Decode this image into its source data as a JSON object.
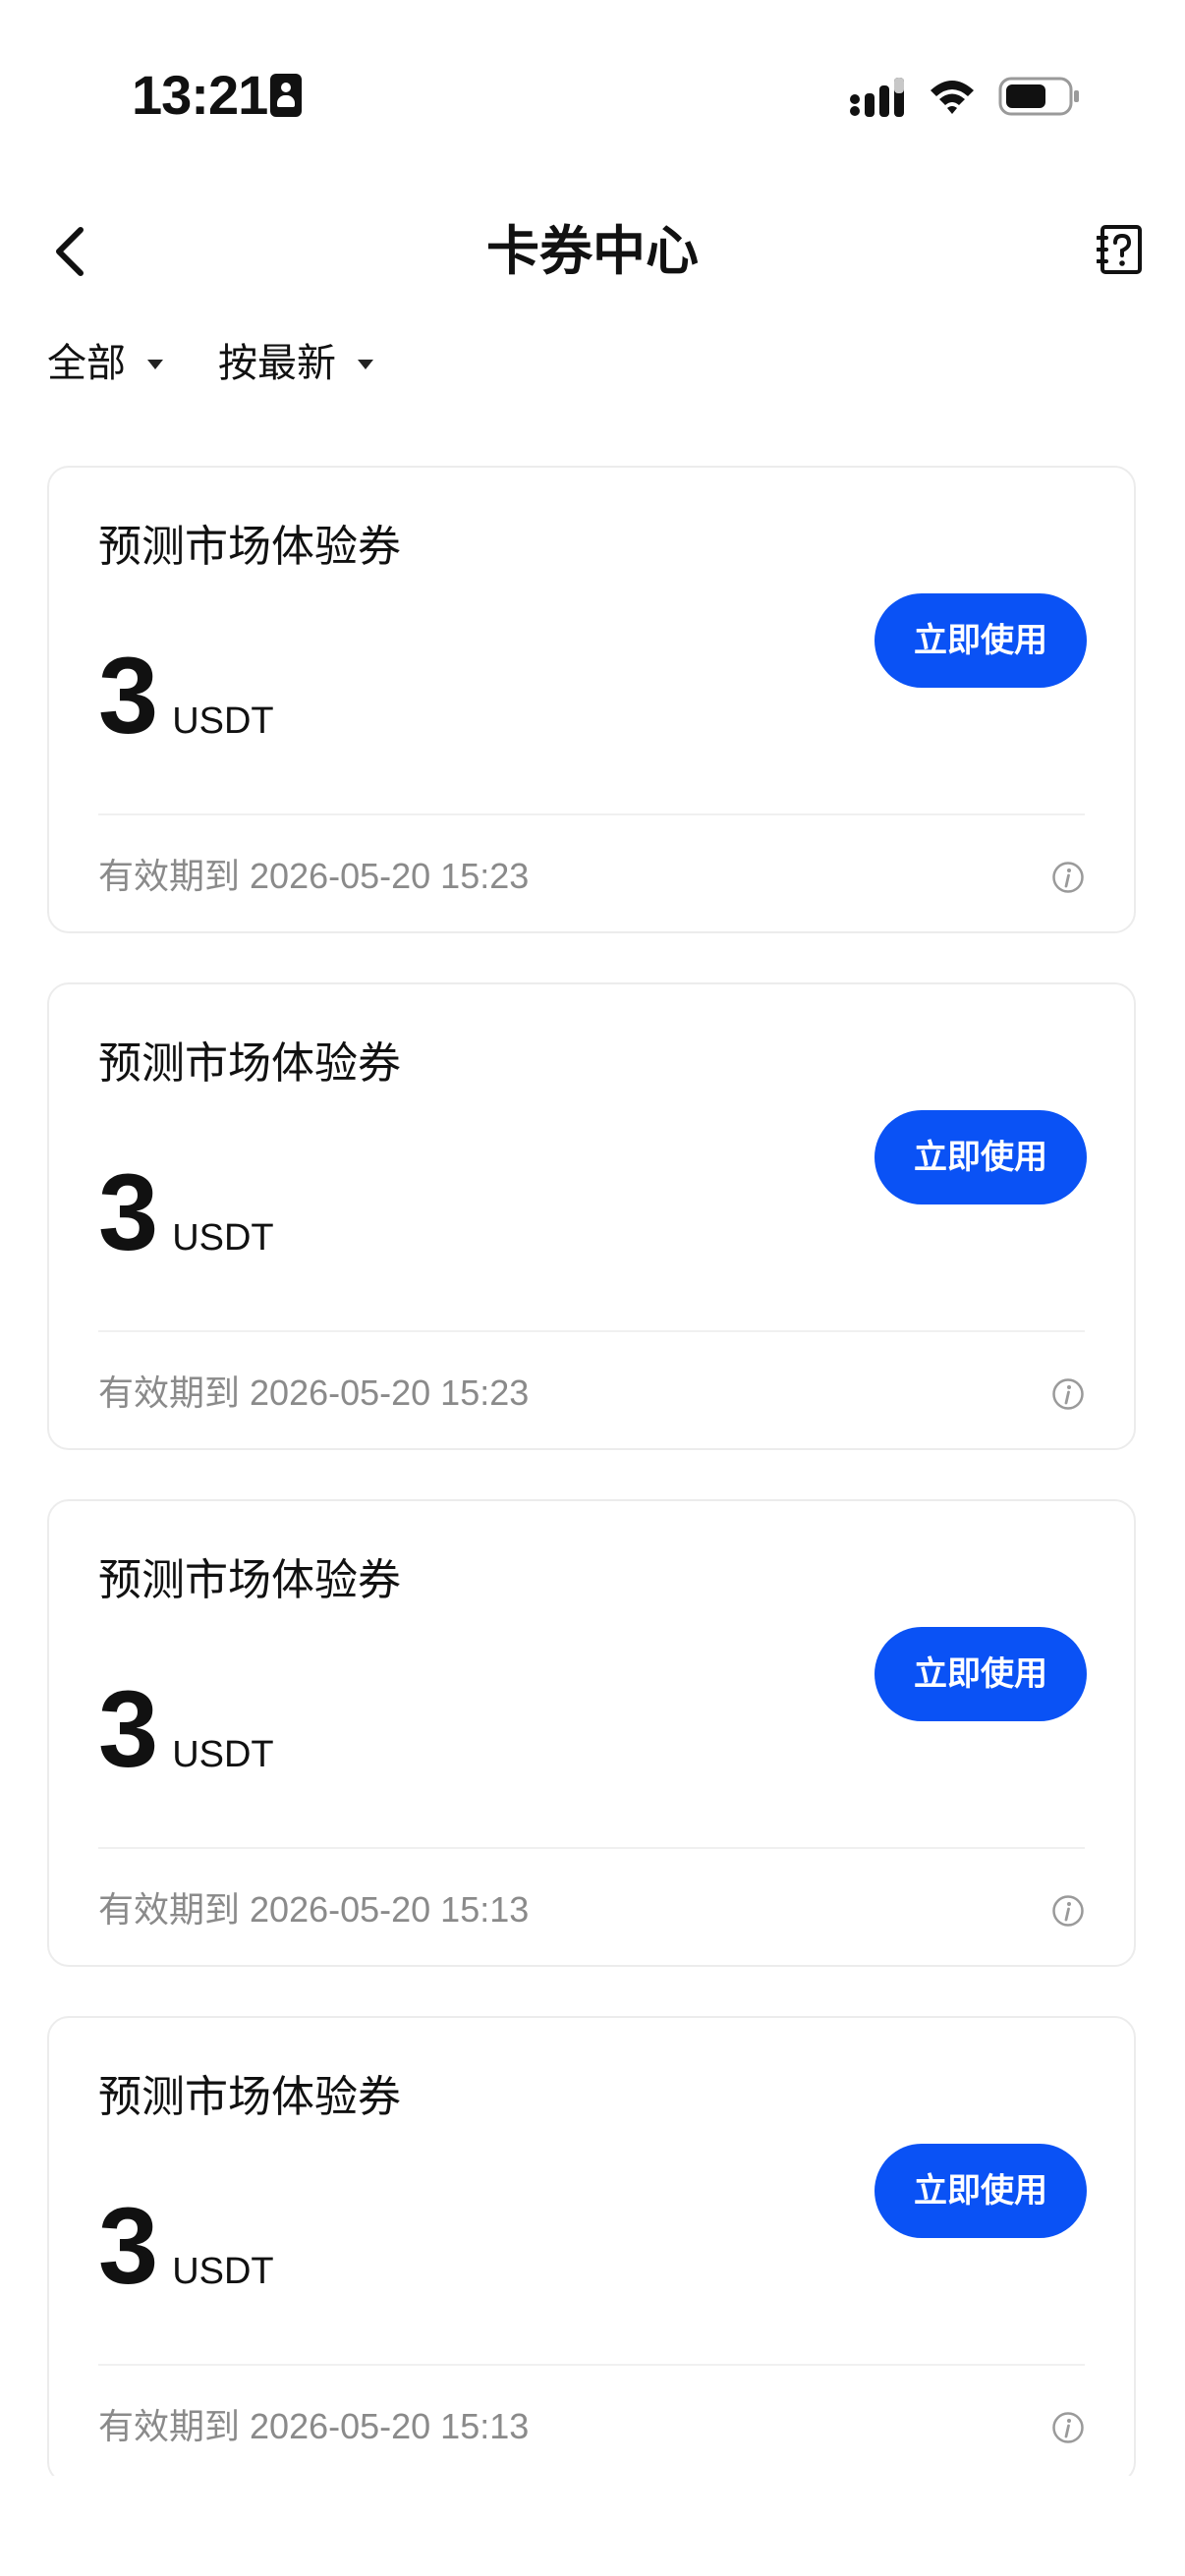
{
  "status_bar": {
    "time": "13:21"
  },
  "nav": {
    "title": "卡券中心"
  },
  "filters": [
    {
      "label": "全部"
    },
    {
      "label": "按最新"
    }
  ],
  "coupons": [
    {
      "name": "预测市场体验券",
      "amount": "3",
      "currency": "USDT",
      "button_label": "立即使用",
      "expiry_label": "有效期到",
      "expiry_time": "2026-05-20 15:23"
    },
    {
      "name": "预测市场体验券",
      "amount": "3",
      "currency": "USDT",
      "button_label": "立即使用",
      "expiry_label": "有效期到",
      "expiry_time": "2026-05-20 15:23"
    },
    {
      "name": "预测市场体验券",
      "amount": "3",
      "currency": "USDT",
      "button_label": "立即使用",
      "expiry_label": "有效期到",
      "expiry_time": "2026-05-20 15:13"
    },
    {
      "name": "预测市场体验券",
      "amount": "3",
      "currency": "USDT",
      "button_label": "立即使用",
      "expiry_label": "有效期到",
      "expiry_time": "2026-05-20 15:13"
    }
  ],
  "colors": {
    "accent": "#0a52f5",
    "text_primary": "#111111",
    "text_secondary": "#8a8a8a",
    "card_border": "#ececec"
  },
  "icons": {
    "back": "chevron-left-icon",
    "help": "help-document-icon",
    "dropdown": "caret-down-icon",
    "info": "info-icon",
    "signal": "cellular-signal-icon",
    "wifi": "wifi-icon",
    "battery": "battery-icon",
    "id": "id-badge-icon"
  }
}
